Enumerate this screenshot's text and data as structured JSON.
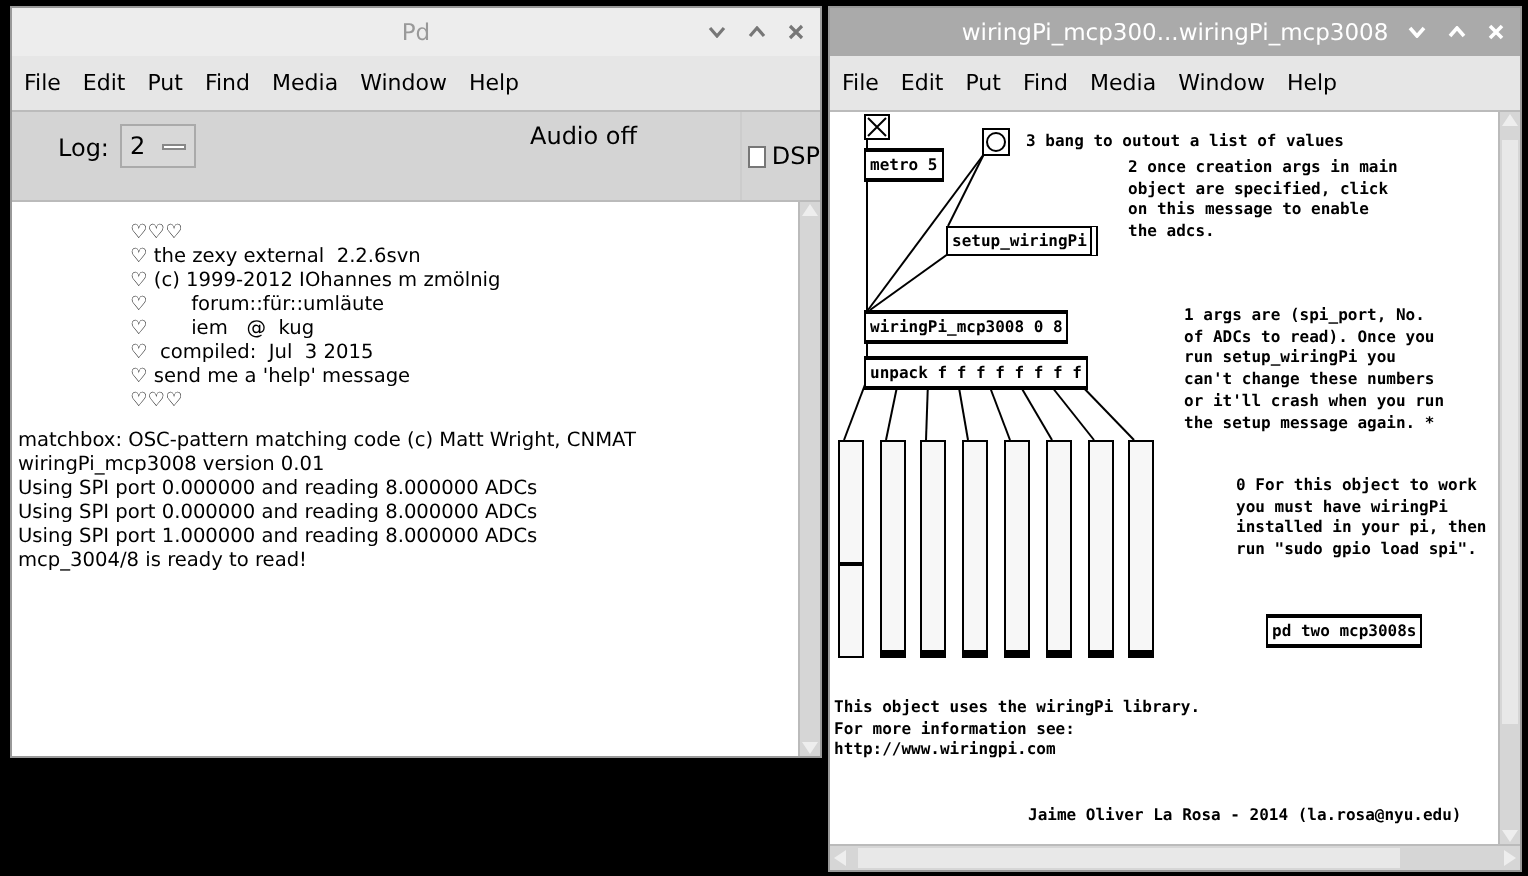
{
  "pd_window": {
    "title": "Pd",
    "menu": [
      "File",
      "Edit",
      "Put",
      "Find",
      "Media",
      "Window",
      "Help"
    ],
    "log_label": "Log:",
    "log_level": "2",
    "audio_status": "Audio off",
    "dsp": {
      "label": "DSP",
      "checked": false
    },
    "console": [
      {
        "kind": "banner",
        "text": "♡♡♡"
      },
      {
        "kind": "banner",
        "text": "♡ the zexy external  2.2.6svn"
      },
      {
        "kind": "banner",
        "text": "♡ (c) 1999-2012 IOhannes m zmölnig"
      },
      {
        "kind": "banner",
        "text": "♡       forum::für::umläute"
      },
      {
        "kind": "banner",
        "text": "♡       iem   @  kug"
      },
      {
        "kind": "banner",
        "text": "♡  compiled:  Jul  3 2015"
      },
      {
        "kind": "banner",
        "text": "♡ send me a 'help' message"
      },
      {
        "kind": "banner",
        "text": "♡♡♡"
      },
      {
        "kind": "plain",
        "text": "matchbox: OSC-pattern matching code (c) Matt Wright, CNMAT"
      },
      {
        "kind": "plain",
        "text": "wiringPi_mcp3008 version 0.01"
      },
      {
        "kind": "plain",
        "text": "Using SPI port 0.000000 and reading 8.000000 ADCs"
      },
      {
        "kind": "plain",
        "text": "Using SPI port 0.000000 and reading 8.000000 ADCs"
      },
      {
        "kind": "plain",
        "text": "Using SPI port 1.000000 and reading 8.000000 ADCs"
      },
      {
        "kind": "plain",
        "text": "mcp_3004/8 is ready to read!"
      }
    ]
  },
  "patch_window": {
    "title": "wiringPi_mcp300...wiringPi_mcp3008",
    "menu": [
      "File",
      "Edit",
      "Put",
      "Find",
      "Media",
      "Window",
      "Help"
    ],
    "objects": [
      {
        "kind": "toggle",
        "checked": true
      },
      {
        "kind": "bang"
      },
      {
        "kind": "object",
        "text": "metro 5"
      },
      {
        "kind": "comment",
        "lines": [
          "3 bang to outout a list of values"
        ]
      },
      {
        "kind": "message",
        "text": "setup_wiringPi"
      },
      {
        "kind": "comment",
        "lines": [
          "2 once creation args in main",
          "object are specified, click",
          "on this message to enable",
          "the adcs."
        ]
      },
      {
        "kind": "object",
        "text": "wiringPi_mcp3008 0 8"
      },
      {
        "kind": "object",
        "text": "unpack f f f f f f f f"
      },
      {
        "kind": "comment",
        "lines": [
          "1 args are (spi_port, No.",
          "of ADCs to read). Once you",
          "run setup_wiringPi you",
          "can't change these numbers",
          "or it'll crash when you run",
          "the setup message again. *"
        ]
      },
      {
        "kind": "comment",
        "lines": [
          "0 For this object to work",
          "you must have wiringPi",
          "installed in your pi, then",
          "run \"sudo gpio load spi\"."
        ]
      },
      {
        "kind": "object",
        "text": "pd two mcp3008s"
      },
      {
        "kind": "comment",
        "lines": [
          "This object uses the wiringPi library.",
          "For more information see:",
          "http://www.wiringpi.com"
        ]
      },
      {
        "kind": "comment",
        "lines": [
          "Jaime Oliver La Rosa - 2014 (la.rosa@nyu.edu)"
        ]
      }
    ],
    "sliders": [
      {
        "level": 0.44
      },
      {
        "level": 0
      },
      {
        "level": 0
      },
      {
        "level": 0
      },
      {
        "level": 0
      },
      {
        "level": 0
      },
      {
        "level": 0
      },
      {
        "level": 0
      }
    ]
  }
}
